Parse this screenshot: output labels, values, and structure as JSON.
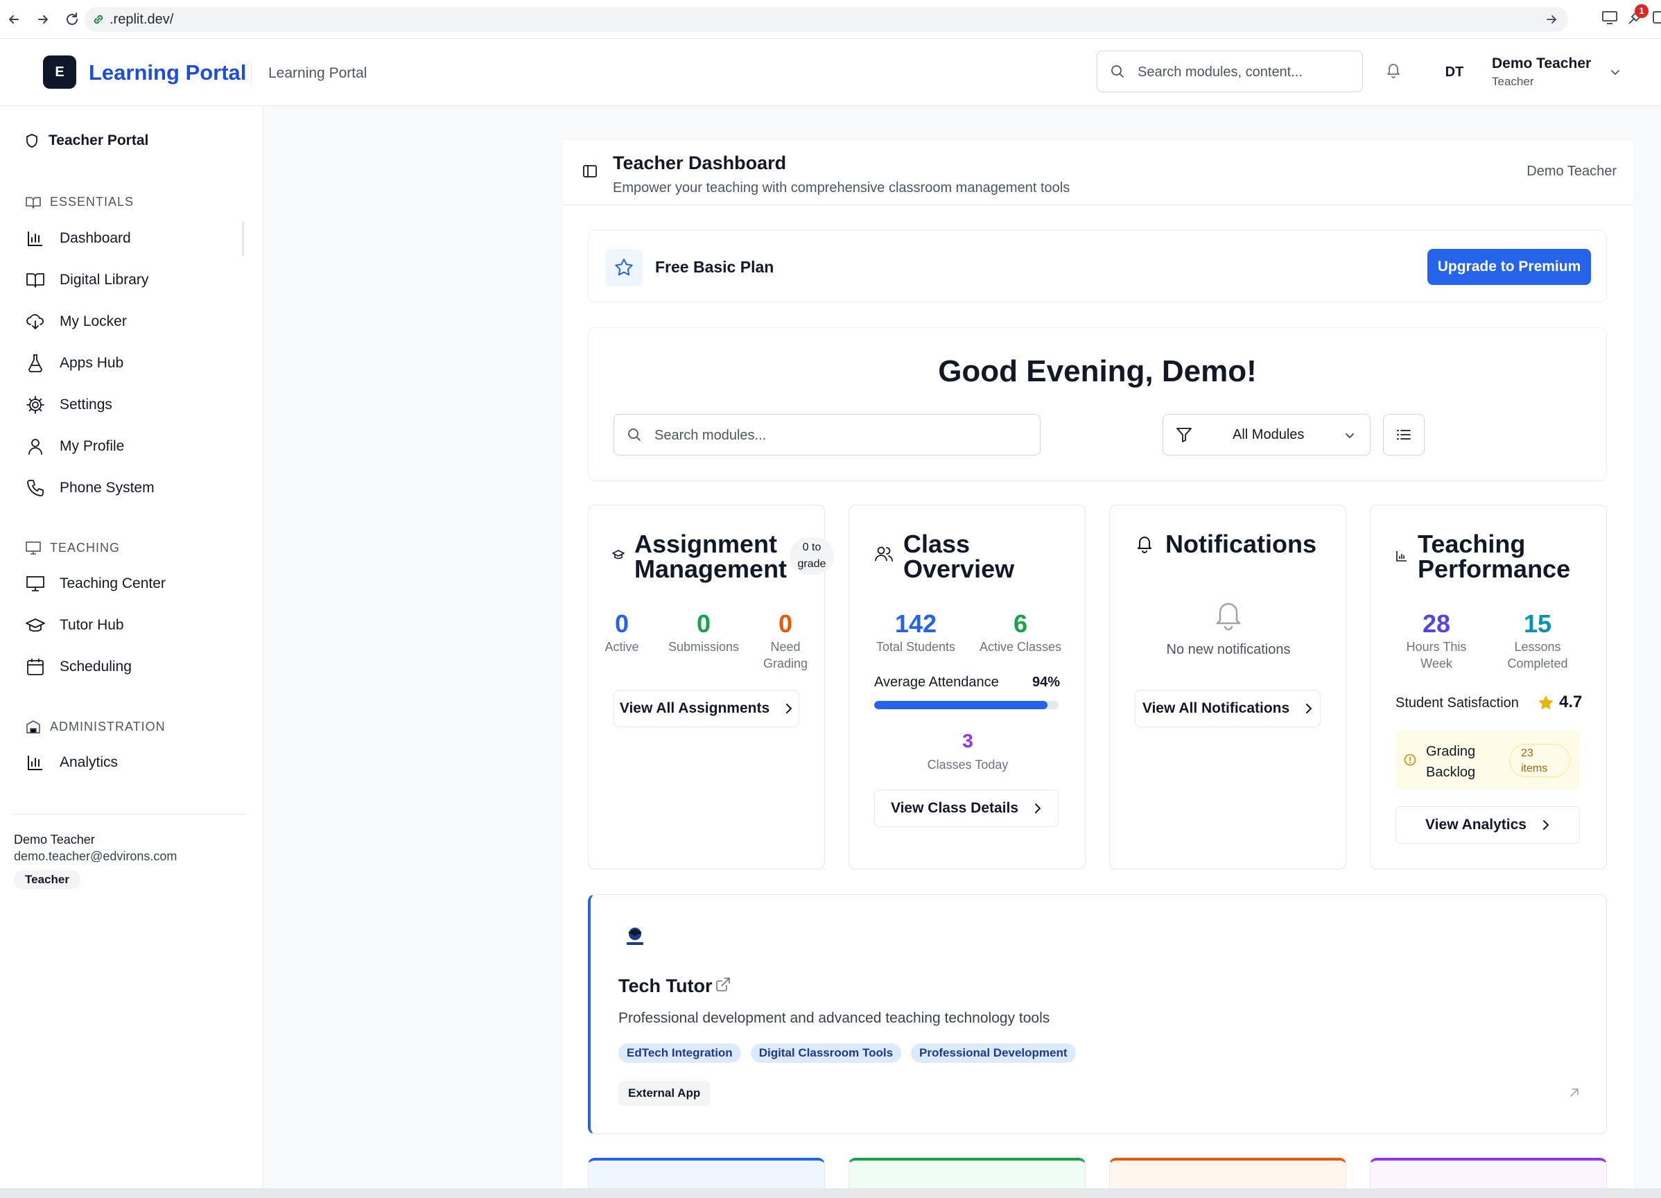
{
  "browser": {
    "url": ".replit.dev/",
    "extension_badge": "1"
  },
  "header": {
    "logo_letter": "E",
    "brand_title": "Learning Portal",
    "brand_subtitle": "Learning Portal",
    "search_placeholder": "Search modules, content...",
    "avatar_initials": "DT",
    "user_name": "Demo Teacher",
    "user_role": "Teacher"
  },
  "sidebar": {
    "portal_label": "Teacher Portal",
    "sections": {
      "essentials": "ESSENTIALS",
      "teaching": "TEACHING",
      "administration": "ADMINISTRATION"
    },
    "essentials_items": [
      {
        "label": "Dashboard",
        "icon": "bar-chart-icon"
      },
      {
        "label": "Digital Library",
        "icon": "book-icon"
      },
      {
        "label": "My Locker",
        "icon": "cloud-download-icon"
      },
      {
        "label": "Apps Hub",
        "icon": "flask-icon"
      },
      {
        "label": "Settings",
        "icon": "gear-icon"
      },
      {
        "label": "My Profile",
        "icon": "user-icon"
      },
      {
        "label": "Phone System",
        "icon": "phone-icon"
      }
    ],
    "teaching_items": [
      {
        "label": "Teaching Center",
        "icon": "presentation-icon"
      },
      {
        "label": "Tutor Hub",
        "icon": "graduation-cap-icon"
      },
      {
        "label": "Scheduling",
        "icon": "calendar-icon"
      }
    ],
    "administration_items": [
      {
        "label": "Analytics",
        "icon": "bar-chart-icon"
      }
    ],
    "user": {
      "name": "Demo Teacher",
      "email": "demo.teacher@edvirons.com",
      "role_badge": "Teacher"
    }
  },
  "dashboard": {
    "title": "Teacher Dashboard",
    "subtitle": "Empower your teaching with comprehensive classroom management tools",
    "user_label": "Demo Teacher",
    "plan_label": "Free Basic Plan",
    "upgrade_label": "Upgrade to Premium",
    "greeting": "Good Evening, Demo!",
    "module_search_placeholder": "Search modules...",
    "filter_value": "All Modules"
  },
  "cards": {
    "assignments": {
      "title_line1": "Assignment",
      "title_line2": "Management",
      "pill_line1": "0 to",
      "pill_line2": "grade",
      "stats": [
        {
          "value": "0",
          "label_line1": "Active",
          "label_line2": ""
        },
        {
          "value": "0",
          "label_line1": "Submissions",
          "label_line2": ""
        },
        {
          "value": "0",
          "label_line1": "Need",
          "label_line2": "Grading"
        }
      ],
      "button": "View All Assignments"
    },
    "class_overview": {
      "title_line1": "Class",
      "title_line2": "Overview",
      "stats": [
        {
          "value": "142",
          "label": "Total Students"
        },
        {
          "value": "6",
          "label": "Active Classes"
        }
      ],
      "attendance_label": "Average Attendance",
      "attendance_value": "94%",
      "attendance_fraction": 0.94,
      "classes_today_value": "3",
      "classes_today_label": "Classes Today",
      "button": "View Class Details"
    },
    "notifications": {
      "title": "Notifications",
      "empty_text": "No new notifications",
      "button": "View All Notifications"
    },
    "performance": {
      "title_line1": "Teaching",
      "title_line2": "Performance",
      "stats": [
        {
          "value": "28",
          "label_line1": "Hours This",
          "label_line2": "Week"
        },
        {
          "value": "15",
          "label_line1": "Lessons",
          "label_line2": "Completed"
        }
      ],
      "satisfaction_label": "Student Satisfaction",
      "satisfaction_value": "4.7",
      "backlog_line1": "Grading",
      "backlog_line2": "Backlog",
      "backlog_count_line1": "23",
      "backlog_count_line2": "items",
      "button": "View Analytics"
    }
  },
  "tutor": {
    "title": "Tech Tutor",
    "description": "Professional development and advanced teaching technology tools",
    "tags": [
      "EdTech Integration",
      "Digital Classroom Tools",
      "Professional Development"
    ],
    "badge": "External App"
  },
  "colors": {
    "primary": "#2563eb",
    "brand": "#1d4ed8",
    "stat_blue": "#2563eb",
    "stat_green": "#16a34a",
    "stat_orange": "#ea580c",
    "stat_purple": "#9333ea",
    "stat_teal": "#0891b2",
    "star": "#eab308"
  }
}
